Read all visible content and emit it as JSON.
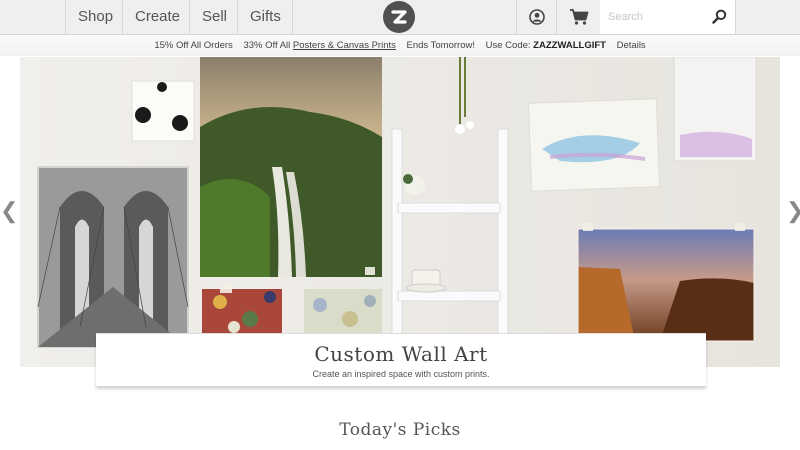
{
  "nav": {
    "shop": "Shop",
    "create": "Create",
    "sell": "Sell",
    "gifts": "Gifts"
  },
  "logo": {
    "icon": "zazzle-logo-icon",
    "letter": "Z"
  },
  "icons": {
    "account": "user-icon",
    "cart": "cart-icon",
    "search": "search-icon"
  },
  "search": {
    "placeholder": "Search",
    "value": ""
  },
  "promo": {
    "item1": "15% Off All Orders",
    "item2_prefix": "33% Off All ",
    "item2_link": "Posters & Canvas Prints",
    "item3": "Ends Tomorrow!",
    "item4_prefix": "Use Code: ",
    "code": "ZAZZWALLGIFT",
    "details": "Details"
  },
  "hero": {
    "title": "Custom Wall Art",
    "subtitle": "Create an inspired space with custom prints.",
    "prev_arrow": "❮",
    "next_arrow": "❯"
  },
  "sections": {
    "todays_picks": "Today's Picks"
  },
  "colors": {
    "header_bg": "#efefef",
    "logo_bg": "#505050",
    "hero_bg": "#eceae6"
  }
}
